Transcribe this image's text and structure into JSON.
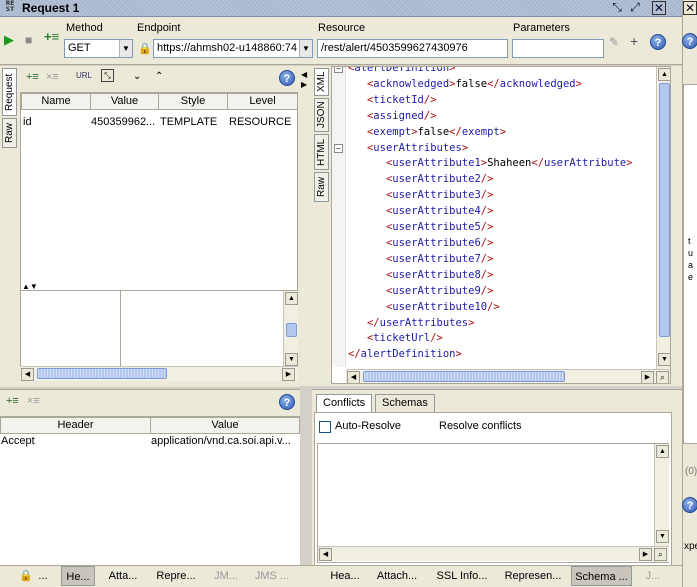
{
  "window": {
    "title": "Request 1",
    "logo_text": "RE ST"
  },
  "toolbar": {
    "method_label": "Method",
    "method_value": "GET",
    "endpoint_label": "Endpoint",
    "endpoint_value": "https://ahmsh02-u148860:74",
    "resource_label": "Resource",
    "resource_value": "/rest/alert/4503599627430976",
    "parameters_label": "Parameters",
    "parameters_value": ""
  },
  "request_panel": {
    "side_tabs": [
      "Request",
      "Raw"
    ],
    "columns": [
      "Name",
      "Value",
      "Style",
      "Level"
    ],
    "rows": [
      {
        "name": "id",
        "value": "450359962...",
        "style": "TEMPLATE",
        "level": "RESOURCE"
      }
    ]
  },
  "headers_panel": {
    "columns": [
      "Header",
      "Value"
    ],
    "rows": [
      {
        "header": "Accept",
        "value": "application/vnd.ca.soi.api.v..."
      }
    ]
  },
  "response_panel": {
    "side_tabs": [
      "XML",
      "JSON",
      "HTML",
      "Raw"
    ],
    "xml_lines": [
      {
        "indent": 0,
        "open": "alertDefinition",
        "text": "",
        "close": ""
      },
      {
        "indent": 1,
        "open": "acknowledged",
        "text": "false",
        "close": "acknowledged"
      },
      {
        "indent": 1,
        "selfclose": "ticketId"
      },
      {
        "indent": 1,
        "selfclose": "assigned"
      },
      {
        "indent": 1,
        "open": "exempt",
        "text": "false",
        "close": "exempt"
      },
      {
        "indent": 1,
        "open": "userAttributes",
        "text": "",
        "close": ""
      },
      {
        "indent": 2,
        "open": "userAttribute1",
        "text": "Shaheen",
        "close": "userAttribute"
      },
      {
        "indent": 2,
        "selfclose": "userAttribute2"
      },
      {
        "indent": 2,
        "selfclose": "userAttribute3"
      },
      {
        "indent": 2,
        "selfclose": "userAttribute4"
      },
      {
        "indent": 2,
        "selfclose": "userAttribute5"
      },
      {
        "indent": 2,
        "selfclose": "userAttribute6"
      },
      {
        "indent": 2,
        "selfclose": "userAttribute7"
      },
      {
        "indent": 2,
        "selfclose": "userAttribute8"
      },
      {
        "indent": 2,
        "selfclose": "userAttribute9"
      },
      {
        "indent": 2,
        "selfclose": "userAttribute10"
      },
      {
        "indent": 1,
        "closeonly": "userAttributes"
      },
      {
        "indent": 1,
        "selfclose": "ticketUrl"
      },
      {
        "indent": 0,
        "closeonly": "alertDefinition"
      }
    ]
  },
  "conflicts_panel": {
    "tabs": [
      "Conflicts",
      "Schemas"
    ],
    "auto_resolve_label": "Auto-Resolve",
    "resolve_label": "Resolve conflicts"
  },
  "bottom_tabs_left": [
    {
      "label": "...",
      "state": "normal"
    },
    {
      "label": "He...",
      "state": "active"
    },
    {
      "label": "Atta...",
      "state": "normal"
    },
    {
      "label": "Repre...",
      "state": "normal"
    },
    {
      "label": "JM...",
      "state": "disabled"
    },
    {
      "label": "JMS ...",
      "state": "disabled"
    }
  ],
  "bottom_tabs_right": [
    {
      "label": "Hea...",
      "state": "normal"
    },
    {
      "label": "Attach...",
      "state": "normal"
    },
    {
      "label": "SSL Info...",
      "state": "normal"
    },
    {
      "label": "Represen...",
      "state": "normal"
    },
    {
      "label": "Schema ...",
      "state": "active"
    },
    {
      "label": "J...",
      "state": "disabled"
    }
  ],
  "right_edge": {
    "text_lines": [
      "t",
      "u",
      "a",
      "e"
    ],
    "bottom_fragments": [
      "(0)",
      "xpec"
    ]
  },
  "colors": {
    "accent": "#2c5ab4",
    "tag": "#1c1ca8",
    "bracket": "#b01010",
    "titlebar": "#a9b8cf"
  }
}
